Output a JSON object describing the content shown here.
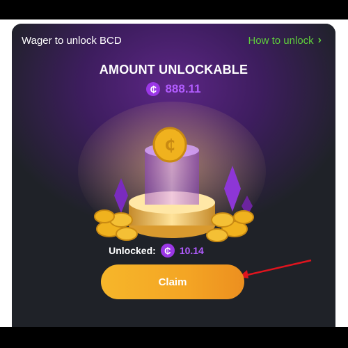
{
  "header": {
    "title": "Wager to unlock BCD",
    "how_to_unlock": "How to unlock"
  },
  "amount": {
    "title": "AMOUNT UNLOCKABLE",
    "currency_symbol": "₵",
    "value": "888.11"
  },
  "unlocked": {
    "label": "Unlocked:",
    "currency_symbol": "₵",
    "value": "10.14"
  },
  "claim": {
    "label": "Claim"
  },
  "colors": {
    "accent_purple": "#b25cff",
    "link_green": "#5fce3c",
    "claim_orange": "#f4a524",
    "arrow_red": "#e0141e"
  }
}
